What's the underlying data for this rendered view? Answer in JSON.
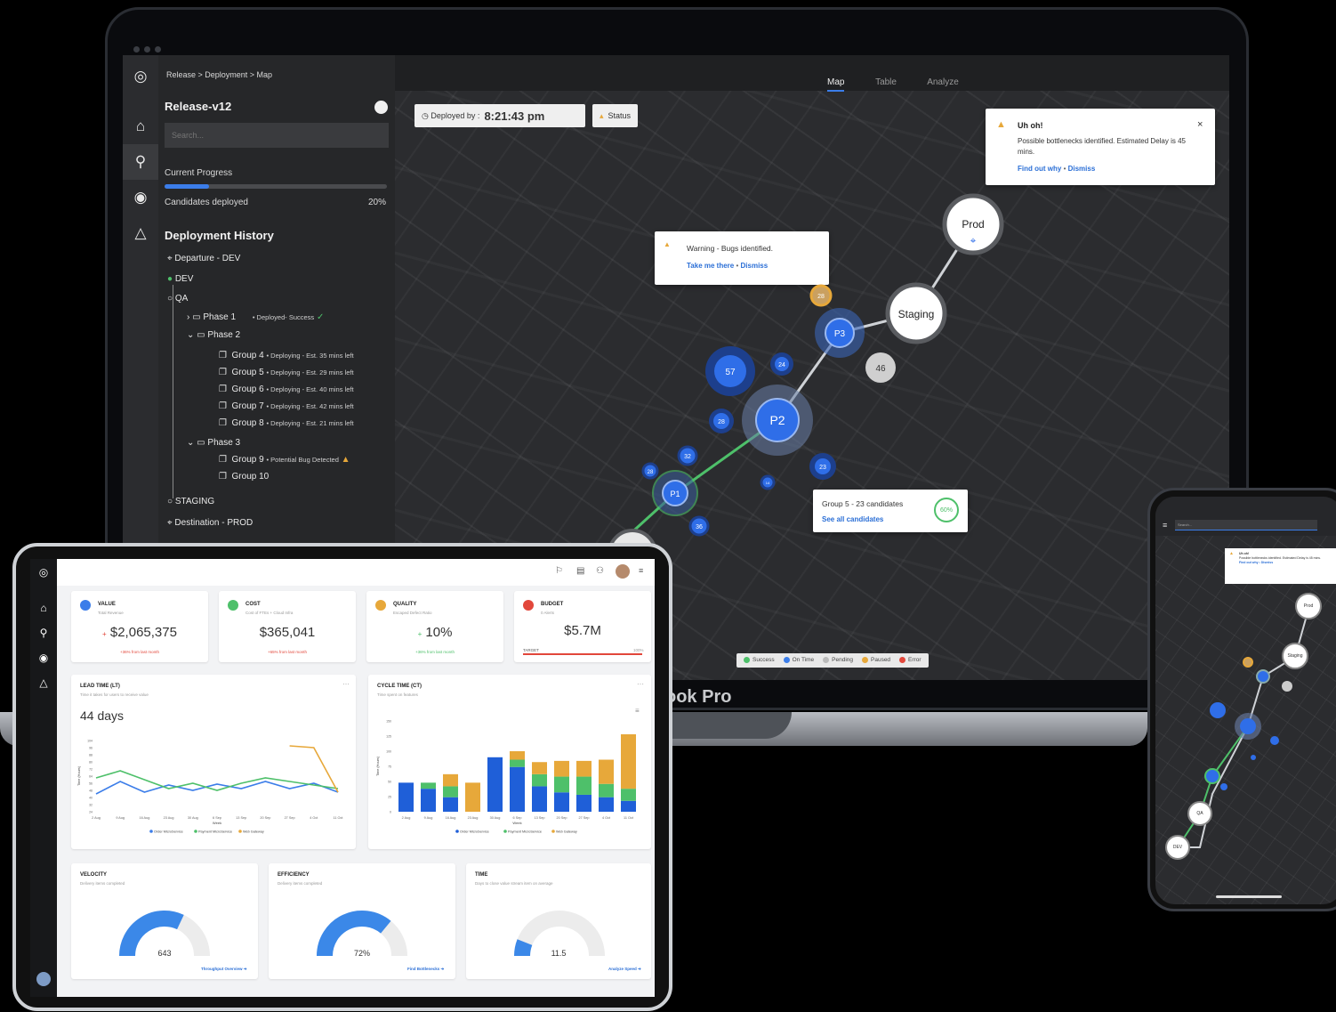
{
  "desktop": {
    "breadcrumb": "Release > Deployment > Map",
    "release_title": "Release-v12",
    "search_placeholder": "Search...",
    "progress_label": "Current Progress",
    "progress_fraction": 0.2,
    "candidates_label": "Candidates deployed",
    "candidates_value": "20%",
    "history_title": "Deployment History",
    "departure": "Departure - DEV",
    "dev": "DEV",
    "qa": "QA",
    "phase1": "Phase 1",
    "phase1_status": "• Deployed- Success",
    "phase2": "Phase 2",
    "groups": [
      {
        "name": "Group 4",
        "status": "• Deploying - Est. 35 mins left"
      },
      {
        "name": "Group 5",
        "status": "• Deploying - Est. 29 mins left"
      },
      {
        "name": "Group 6",
        "status": "• Deploying - Est. 40 mins left"
      },
      {
        "name": "Group 7",
        "status": "• Deploying - Est. 42 mins left"
      },
      {
        "name": "Group 8",
        "status": "• Deploying - Est. 21 mins left"
      }
    ],
    "phase3": "Phase 3",
    "group9": "Group 9",
    "group9_status": "• Potential Bug Detected",
    "group10": "Group 10",
    "staging": "STAGING",
    "destination": "Destination - PROD",
    "tabs": [
      "Map",
      "Table",
      "Analyze"
    ],
    "deployed_by_label": "Deployed by :",
    "deployed_by_time": "8:21:43  pm",
    "status_label": "Status",
    "alert_title": "Uh oh!",
    "alert_text": "Possible bottlenecks identified. Estimated Delay is 45 mins.",
    "alert_link1": "Find out why",
    "alert_link2": "Dismiss",
    "warning_text": "Warning - Bugs identified.",
    "warning_link1": "Take me there",
    "warning_link2": "Dismiss",
    "group_card_title": "Group 5 - 23 candidates",
    "group_card_link": "See all candidates",
    "group_card_pct": "60%",
    "nodes": {
      "prod": "Prod",
      "staging": "Staging",
      "p3": "P3",
      "p2": "P2",
      "p1": "P1",
      "n46": "46",
      "n57": "57",
      "n24": "24",
      "n28a": "28",
      "n28b": "28",
      "n28c": "28",
      "n23": "23",
      "n32": "32",
      "n36": "36",
      "n14": "14"
    },
    "legend": [
      "Success",
      "On Time",
      "Pending",
      "Paused",
      "Error"
    ],
    "legend_colors": [
      "#4ec06a",
      "#3b7de9",
      "#bbbbbb",
      "#e7a83a",
      "#e2473b"
    ],
    "device_label": "ook Pro"
  },
  "tablet": {
    "kpis": [
      {
        "title": "VALUE",
        "sub": "Total Revenue",
        "value": "$2,065,375",
        "note": "+36% from last month",
        "color": "#3b7de9"
      },
      {
        "title": "COST",
        "sub": "Cost of FTEs + Cloud Infra",
        "value": "$365,041",
        "note": "+65% from last month",
        "color": "#4ec06a"
      },
      {
        "title": "QUALITY",
        "sub": "Escaped Defect Ratio",
        "value": "10%",
        "note": "+36% from last month",
        "color": "#e7a83a"
      },
      {
        "title": "BUDGET",
        "sub": "0 Alerts",
        "value": "$5.7M",
        "note": "TARGET",
        "note2": "100%",
        "color": "#e2473b"
      }
    ],
    "lead": {
      "title": "LEAD TIME (LT)",
      "sub": "Time it takes for users to receive value",
      "value": "44 days",
      "xlabel": "Week",
      "ylabel": "Time (Hours)"
    },
    "cycle": {
      "title": "CYCLE TIME (CT)",
      "sub": "Time spent on features",
      "xlabel": "Week",
      "ylabel": "Time (Hours)"
    },
    "velocity": {
      "title": "VELOCITY",
      "sub": "Delivery items completed",
      "value": "643",
      "link": "Throughput Overview",
      "fraction": 0.64
    },
    "efficiency": {
      "title": "EFFICIENCY",
      "sub": "Delivery items completed",
      "value": "72%",
      "link": "Find Bottlenecks",
      "fraction": 0.72
    },
    "time": {
      "title": "TIME",
      "sub": "Days to close value stream item on average",
      "value": "11.5",
      "link": "Analyze Speed",
      "fraction": 0.12
    }
  },
  "chart_data": [
    {
      "type": "line",
      "title": "LEAD TIME (LT)",
      "xlabel": "Week",
      "ylabel": "Time (Hours)",
      "x": [
        "2 Aug",
        "9 Aug",
        "16 Aug",
        "23 Aug",
        "30 Aug",
        "6 Sep",
        "13 Sep",
        "20 Sep",
        "27 Sep",
        "4 Oct",
        "11 Oct"
      ],
      "yticks": [
        "104",
        "96",
        "88",
        "80",
        "72",
        "64",
        "56",
        "48",
        "40",
        "32",
        "24"
      ],
      "ylim": [
        24,
        104
      ],
      "series": [
        {
          "name": "Order MicroService",
          "color": "#3b7de9",
          "values": [
            44,
            58,
            46,
            54,
            48,
            55,
            50,
            58,
            50,
            56,
            46
          ]
        },
        {
          "name": "Payment MicroService",
          "color": "#4ec06a",
          "values": [
            62,
            70,
            60,
            50,
            56,
            48,
            56,
            62,
            58,
            54,
            50
          ]
        },
        {
          "name": "Web Gateway",
          "color": "#e7a83a",
          "values": [
            null,
            null,
            null,
            null,
            null,
            null,
            null,
            null,
            98,
            96,
            46
          ]
        }
      ]
    },
    {
      "type": "bar",
      "title": "CYCLE TIME (CT)",
      "xlabel": "Week",
      "ylabel": "Time (Hours)",
      "categories": [
        "2 Aug",
        "9 Aug",
        "16 Aug",
        "23 Aug",
        "30 Aug",
        "6 Sep",
        "13 Sep",
        "20 Sep",
        "27 Sep",
        "4 Oct",
        "11 Oct"
      ],
      "yticks": [
        "150",
        "125",
        "100",
        "75",
        "50",
        "25",
        "0"
      ],
      "ylim": [
        0,
        150
      ],
      "series": [
        {
          "name": "Order MicroService",
          "color": "#1f5fd8",
          "values": [
            48,
            38,
            24,
            0,
            90,
            74,
            42,
            32,
            28,
            24,
            18
          ]
        },
        {
          "name": "Payment MicroService",
          "color": "#4ec06a",
          "values": [
            0,
            10,
            18,
            0,
            0,
            12,
            20,
            26,
            30,
            22,
            20
          ]
        },
        {
          "name": "Web Gateway",
          "color": "#e7a83a",
          "values": [
            0,
            0,
            20,
            48,
            0,
            14,
            20,
            26,
            26,
            40,
            90
          ]
        }
      ]
    }
  ],
  "phone": {
    "search_placeholder": "Search...",
    "alert_title": "Uh oh!",
    "alert_text": "Possible bottlenecks identified. Estimated Delay is 45 mins.",
    "alert_link": "Find out why  •  Dismiss",
    "nodes": [
      "Prod",
      "Staging",
      "P3",
      "P2",
      "P1",
      "QA",
      "DEV",
      "46",
      "57"
    ]
  }
}
